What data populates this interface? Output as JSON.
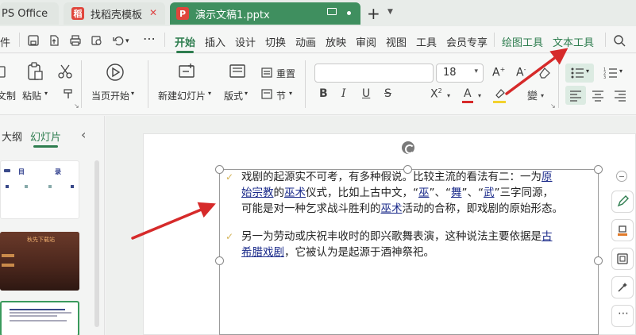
{
  "tabs": {
    "wps": "PS Office",
    "template": "找稻壳模板",
    "document": "演示文稿1.pptx",
    "doc_icon": "P"
  },
  "menu": {
    "file_partial": "件",
    "items": [
      "开始",
      "插入",
      "设计",
      "切换",
      "动画",
      "放映",
      "审阅",
      "视图",
      "工具",
      "会员专享"
    ],
    "context_items": [
      "绘图工具",
      "文本工具"
    ],
    "accent_color": "#2e7d4f"
  },
  "ribbon": {
    "cut_partial": "文制",
    "paste": "粘贴",
    "start_from_current": "当页开始",
    "new_slide": "新建幻灯片",
    "layout": "版式",
    "reset": "重置",
    "section": "节",
    "font_size": "18"
  },
  "left_panel": {
    "outline_tab": "大纲",
    "slides_tab": "幻灯片",
    "thumb1": {
      "title_a": "目",
      "title_b": "录"
    },
    "thumb2": {
      "title": "秋先下载站"
    }
  },
  "slide": {
    "para1": {
      "line1_a": "戏剧的起源实不可考，有多种假说。比较主流的看法有二：一为",
      "line1_link": "原",
      "line2_link1": "始宗教",
      "line2_a": "的",
      "line2_link2": "巫术",
      "line2_b": "仪式，比如上古中文，“",
      "line2_link3": "巫",
      "line2_c": "”、“",
      "line2_link4": "舞",
      "line2_d": "”、“",
      "line2_link5": "武",
      "line2_e": "”三字同源，",
      "line3_a": "可能是对一种乞求战斗胜利的",
      "line3_link": "巫术",
      "line3_b": "活动的合称，即戏剧的原始形态。"
    },
    "para2": {
      "line1_a": "另一为劳动或庆祝丰收时的即兴歌舞表演，这种说法主要依据是",
      "line1_link": "古",
      "line2_link": "希腊戏剧",
      "line2_a": "，它被认为是起源于酒神祭祀。"
    }
  },
  "colors": {
    "tab_active": "#3f8f5f",
    "arrow": "#d62a2a",
    "bullet": "#d4b45a",
    "hyperlink": "#1a2a8a"
  }
}
